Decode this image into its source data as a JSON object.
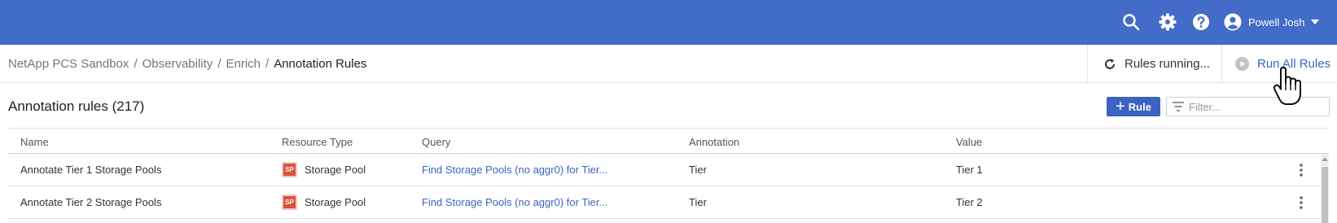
{
  "header": {
    "user_name": "Powell Josh",
    "icons": [
      "search-icon",
      "gear-icon",
      "help-icon",
      "user-avatar-icon",
      "caret-down-icon"
    ],
    "bg_color": "#436cc8"
  },
  "breadcrumb": {
    "items": [
      "NetApp PCS Sandbox",
      "Observability",
      "Enrich"
    ],
    "separator": "/",
    "current": "Annotation Rules"
  },
  "actions": {
    "running_label": "Rules running...",
    "run_all_label": "Run All Rules"
  },
  "section": {
    "title": "Annotation rules (217)",
    "add_label": "Rule",
    "filter_placeholder": "Filter..."
  },
  "table": {
    "columns": [
      "Name",
      "Resource Type",
      "Query",
      "Annotation",
      "Value"
    ],
    "rows": [
      {
        "name": "Annotate Tier 1 Storage Pools",
        "resource_badge": "SP",
        "resource_type": "Storage Pool",
        "query": "Find Storage Pools (no aggr0) for Tier...",
        "annotation": "Tier",
        "value": "Tier 1"
      },
      {
        "name": "Annotate Tier 2 Storage Pools",
        "resource_badge": "SP",
        "resource_type": "Storage Pool",
        "query": "Find Storage Pools (no aggr0) for Tier...",
        "annotation": "Tier",
        "value": "Tier 2"
      }
    ]
  },
  "colors": {
    "accent": "#3a63c2",
    "link": "#3d64c0",
    "badge": "#d9523a"
  }
}
